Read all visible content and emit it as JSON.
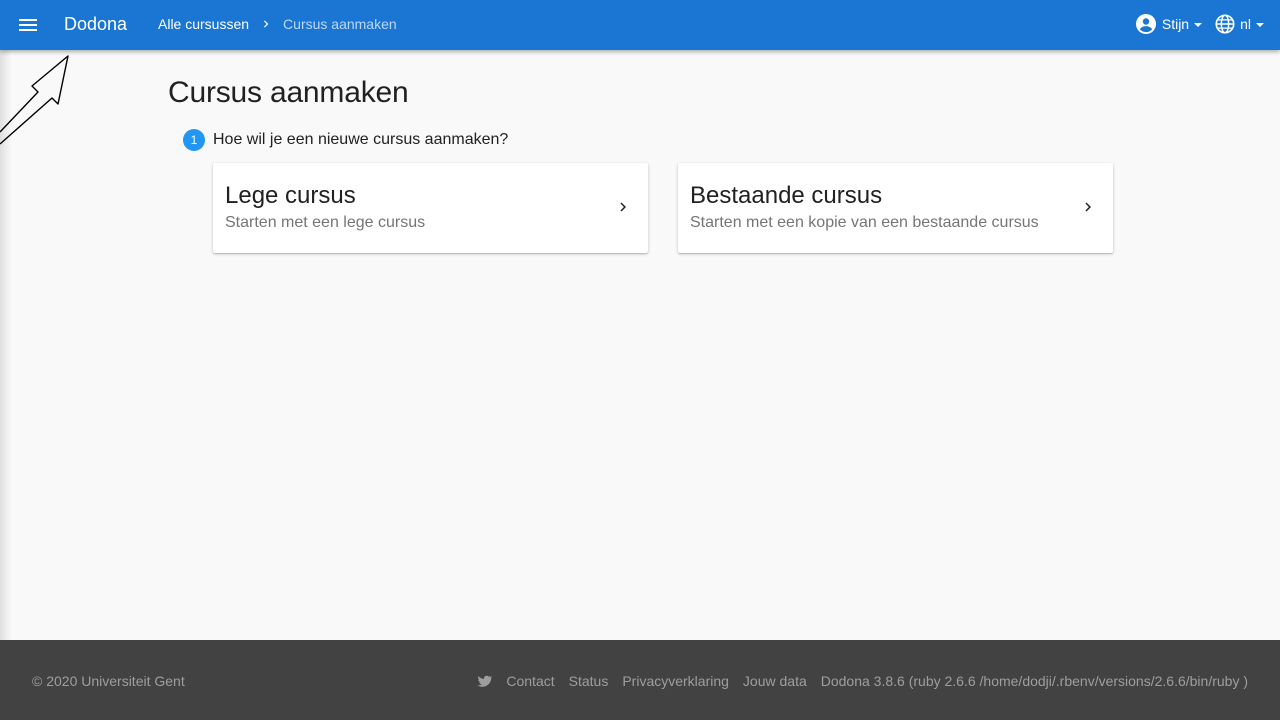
{
  "navbar": {
    "brand": "Dodona",
    "breadcrumb": {
      "parent": "Alle cursussen",
      "current": "Cursus aanmaken"
    },
    "user": "Stijn",
    "language": "nl",
    "color": "#1a76d2"
  },
  "main": {
    "title": "Cursus aanmaken",
    "step": {
      "number": "1",
      "question": "Hoe wil je een nieuwe cursus aanmaken?"
    },
    "options": [
      {
        "title": "Lege cursus",
        "subtitle": "Starten met een lege cursus"
      },
      {
        "title": "Bestaande cursus",
        "subtitle": "Starten met een kopie van een bestaande cursus"
      }
    ]
  },
  "footer": {
    "copyright": "© 2020 Universiteit Gent",
    "links": [
      "Contact",
      "Status",
      "Privacyverklaring",
      "Jouw data"
    ],
    "version": "Dodona 3.8.6 (ruby 2.6.6 /home/dodji/.rbenv/versions/2.6.6/bin/ruby )"
  },
  "icons": {
    "menu": "menu-icon",
    "breadcrumb_sep": "chevron-right-icon",
    "user": "account-circle-icon",
    "language": "globe-icon",
    "card_action": "chevron-right-icon",
    "social": "twitter-icon"
  }
}
